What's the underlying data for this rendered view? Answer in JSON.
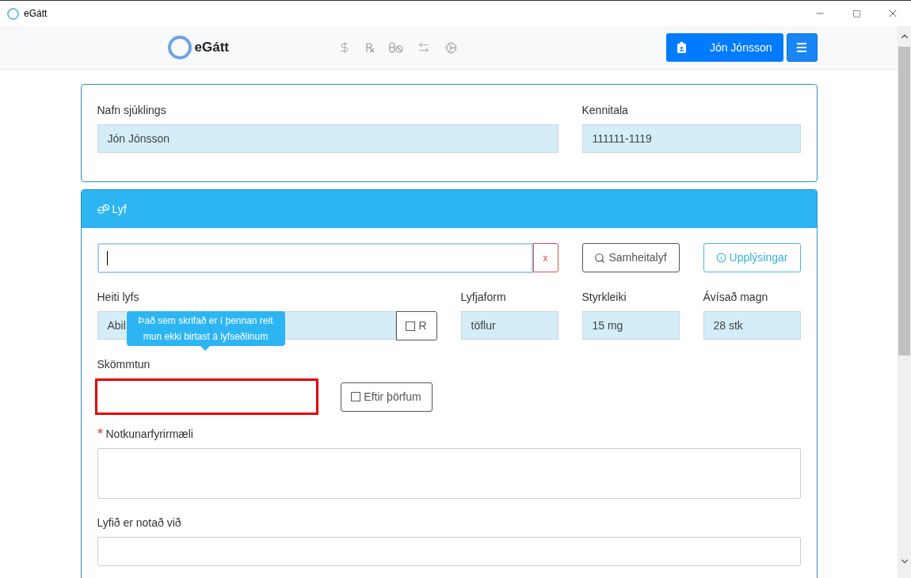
{
  "window": {
    "title": "eGátt"
  },
  "nav": {
    "brand": "eGátt",
    "user": "Jón Jónsson"
  },
  "patient": {
    "fields": [
      {
        "label": "Nafn sjúklings",
        "value": "Jón Jónsson"
      },
      {
        "label": "Kennitala",
        "value": "111111-1119"
      }
    ]
  },
  "drug": {
    "title": "Lyf",
    "search": {
      "clear": "x"
    },
    "buttons": [
      {
        "label": "Samheitalyf",
        "kind": "search"
      },
      {
        "label": "Upplýsingar",
        "kind": "info"
      }
    ],
    "name_field": {
      "label": "Heiti lyfs",
      "value": "Abil",
      "r_label": "R",
      "r_checked": false
    },
    "fields": [
      {
        "label": "Lyfjaform",
        "value": "töflur"
      },
      {
        "label": "Styrkleiki",
        "value": "15 mg"
      },
      {
        "label": "Ávísað magn",
        "value": "28 stk"
      }
    ],
    "tooltip": "Það sem skrifað er í þennan reit mun ekki birtast á lyfseðlinum",
    "dosage": {
      "label": "Skömmtun",
      "highlighted": true,
      "as_needed_label": "Eftir þörfum",
      "as_needed_checked": false
    },
    "instructions": {
      "label": "Notkunarfyrirmæli",
      "required": true
    },
    "used_for": {
      "label": "Lyfið er notað við"
    }
  }
}
